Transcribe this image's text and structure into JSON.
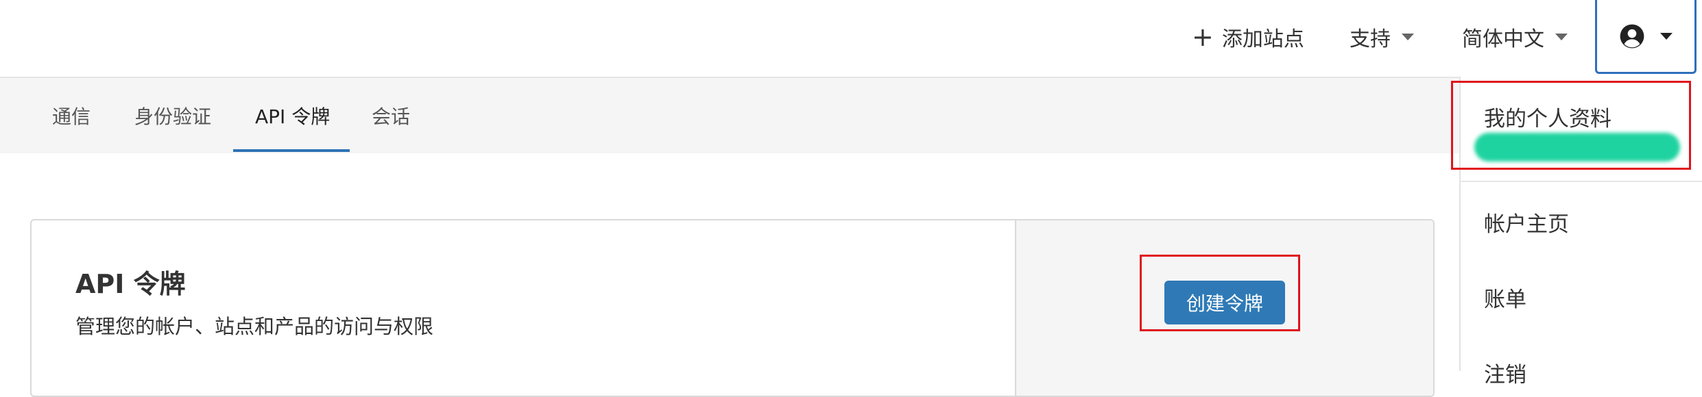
{
  "topbar": {
    "add_site": "添加站点",
    "support": "支持",
    "language": "简体中文"
  },
  "tabs": [
    {
      "label": "通信"
    },
    {
      "label": "身份验证"
    },
    {
      "label": "API 令牌"
    },
    {
      "label": "会话"
    }
  ],
  "card": {
    "title": "API 令牌",
    "subtitle": "管理您的帐户、站点和产品的访问与权限",
    "create_button": "创建令牌"
  },
  "dropdown": {
    "profile": "我的个人资料",
    "account_home": "帐户主页",
    "billing": "账单",
    "logout": "注销"
  },
  "colors": {
    "accent": "#2f7ab6",
    "highlight": "#e0121b",
    "redaction": "#1fd3a0"
  }
}
